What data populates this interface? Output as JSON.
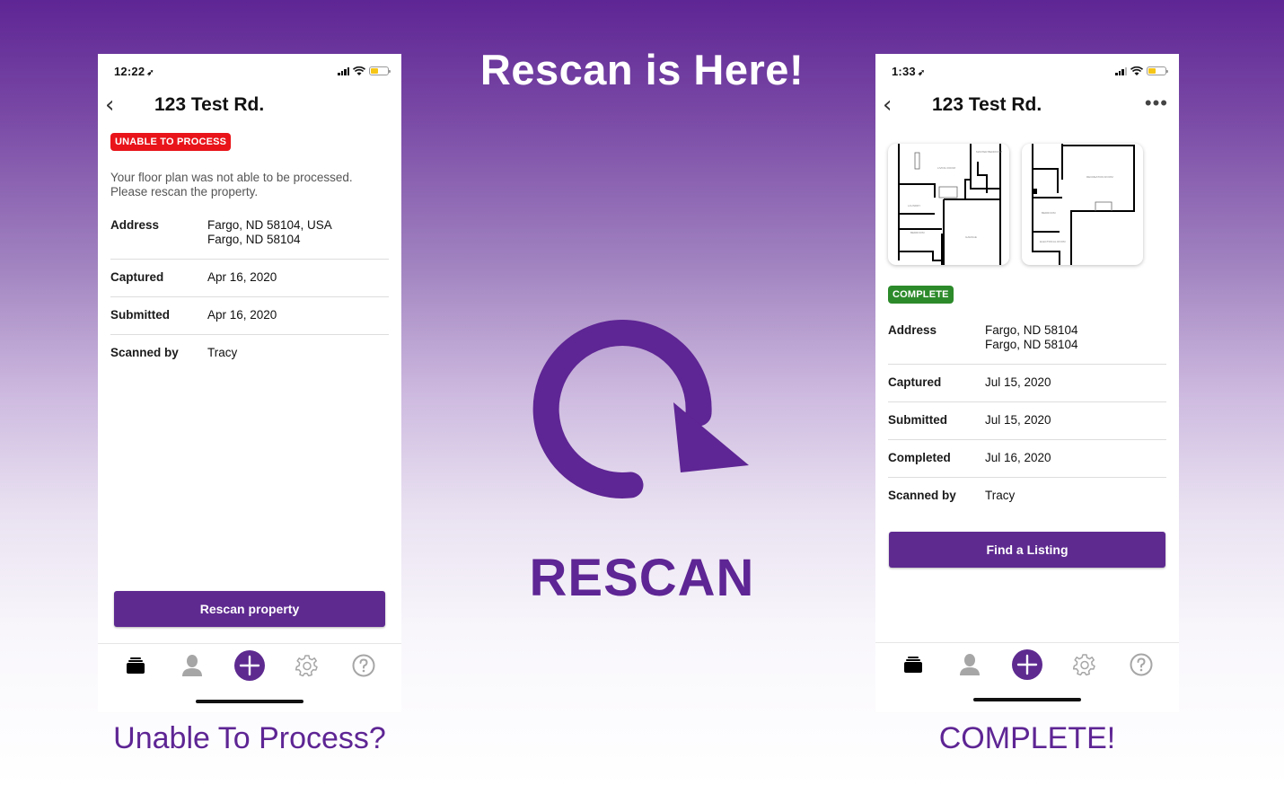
{
  "headline": "Rescan is Here!",
  "center_label": "RESCAN",
  "colors": {
    "brand_purple": "#5e2594",
    "button_purple": "#5e2a90",
    "error_red": "#e8141a",
    "success_green": "#2c8a2a"
  },
  "left_phone": {
    "status_time": "12:22",
    "title": "123 Test Rd.",
    "badge": "UNABLE TO PROCESS",
    "message_line1": "Your floor plan was not able to be processed.",
    "message_line2": "Please rescan the property.",
    "details": [
      {
        "label": "Address",
        "value_line1": "Fargo, ND 58104, USA",
        "value_line2": "Fargo, ND 58104"
      },
      {
        "label": "Captured",
        "value_line1": "Apr 16, 2020"
      },
      {
        "label": "Submitted",
        "value_line1": "Apr 16, 2020"
      },
      {
        "label": "Scanned by",
        "value_line1": "Tracy"
      }
    ],
    "button": "Rescan property",
    "caption": "Unable To Process?"
  },
  "right_phone": {
    "status_time": "1:33",
    "title": "123 Test Rd.",
    "more": "•••",
    "badge": "COMPLETE",
    "details": [
      {
        "label": "Address",
        "value_line1": "Fargo, ND 58104",
        "value_line2": "Fargo, ND 58104"
      },
      {
        "label": "Captured",
        "value_line1": "Jul 15, 2020"
      },
      {
        "label": "Submitted",
        "value_line1": "Jul 15, 2020"
      },
      {
        "label": "Completed",
        "value_line1": "Jul 16, 2020"
      },
      {
        "label": "Scanned by",
        "value_line1": "Tracy"
      }
    ],
    "button": "Find a Listing",
    "caption": "COMPLETE!"
  },
  "tab_bar": {
    "tabs": [
      {
        "icon": "stack-icon",
        "name": "scans"
      },
      {
        "icon": "person-icon",
        "name": "profile"
      },
      {
        "icon": "plus-circle-icon",
        "name": "new-scan"
      },
      {
        "icon": "gear-icon",
        "name": "settings"
      },
      {
        "icon": "help-icon",
        "name": "help"
      }
    ]
  },
  "icons": {
    "back": "‹",
    "location": "➶"
  }
}
